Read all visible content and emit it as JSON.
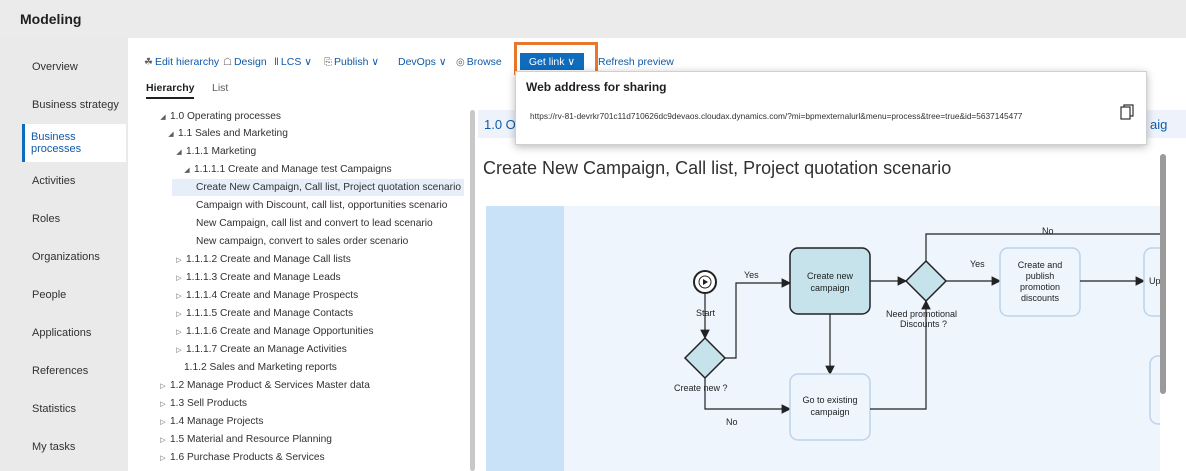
{
  "app": {
    "title": "Modeling"
  },
  "sidebar": {
    "items": [
      {
        "label": "Overview"
      },
      {
        "label": "Business strategy"
      },
      {
        "label": "Business processes"
      },
      {
        "label": "Activities"
      },
      {
        "label": "Roles"
      },
      {
        "label": "Organizations"
      },
      {
        "label": "People"
      },
      {
        "label": "Applications"
      },
      {
        "label": "References"
      },
      {
        "label": "Statistics"
      },
      {
        "label": "My tasks"
      }
    ],
    "active": "Business processes"
  },
  "toolbar": {
    "edit_hierarchy": "Edit hierarchy",
    "design": "Design",
    "lcs": "LCS",
    "publish": "Publish",
    "devops": "DevOps",
    "browse": "Browse",
    "get_link": "Get link",
    "refresh_preview": "Refresh preview"
  },
  "tabs": {
    "hierarchy": "Hierarchy",
    "list": "List"
  },
  "tree": [
    {
      "label": "1.0 Operating processes"
    },
    {
      "label": "1.1 Sales and Marketing"
    },
    {
      "label": "1.1.1 Marketing"
    },
    {
      "label": "1.1.1.1 Create and Manage test Campaigns"
    },
    {
      "label": "Create New Campaign, Call list, Project quotation scenario"
    },
    {
      "label": "Campaign with Discount, call list, opportunities scenario"
    },
    {
      "label": "New Campaign, call list and convert to lead scenario"
    },
    {
      "label": "New campaign, convert to sales order scenario"
    },
    {
      "label": "1.1.1.2 Create and Manage Call lists"
    },
    {
      "label": "1.1.1.3 Create and Manage Leads"
    },
    {
      "label": "1.1.1.4 Create and Manage Prospects"
    },
    {
      "label": "1.1.1.5 Create and Manage Contacts"
    },
    {
      "label": "1.1.1.6 Create and Manage Opportunities"
    },
    {
      "label": "1.1.1.7 Create an Manage Activities"
    },
    {
      "label": "1.1.2 Sales and Marketing reports"
    },
    {
      "label": "1.2 Manage Product & Services Master data"
    },
    {
      "label": "1.3 Sell Products"
    },
    {
      "label": "1.4 Manage Projects"
    },
    {
      "label": "1.5 Material and Resource Planning"
    },
    {
      "label": "1.6 Purchase Products & Services"
    }
  ],
  "content": {
    "breadcrumb": "1.0 O",
    "breadcrumb_right": "aig",
    "heading": "Create New Campaign, Call list, Project quotation scenario"
  },
  "diagram": {
    "start": "Start",
    "create_new_q": "Create new ?",
    "yes1": "Yes",
    "no1": "No",
    "create_new_campaign": [
      "Create new",
      "campaign"
    ],
    "goto_existing": [
      "Go to existing",
      "campaign"
    ],
    "need_promo": [
      "Need promotional",
      "Discounts ?"
    ],
    "yes2": "Yes",
    "no2": "No",
    "create_publish": [
      "Create and",
      "publish",
      "promotion",
      "discounts"
    ],
    "partial_right": "Up"
  },
  "popup": {
    "title": "Web address for sharing",
    "url": "https://rv-81-devrkr701c11d710626dc9devaos.cloudax.dynamics.com/?mi=bpmexternalurl&menu=process&tree=true&id=5637145477"
  },
  "colors": {
    "accent": "#0f6cbd",
    "highlight": "#e8772e",
    "lane": "#c9e2f8"
  }
}
